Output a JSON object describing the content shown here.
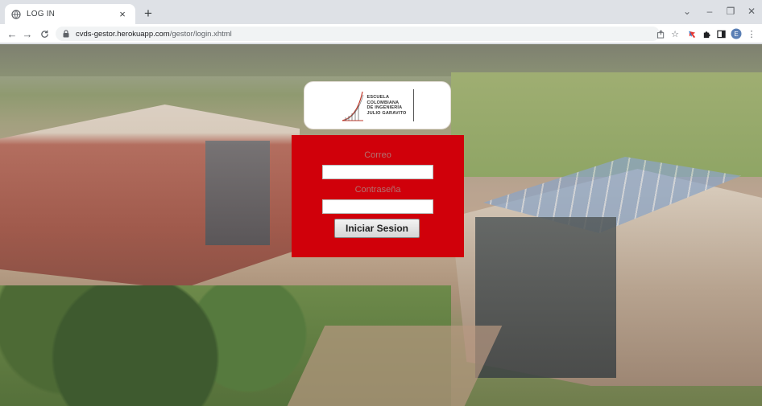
{
  "browser": {
    "tab": {
      "title": "LOG IN",
      "close": "×"
    },
    "new_tab": "+",
    "window": {
      "chevron": "⌄",
      "minimize": "–",
      "maximize": "❐",
      "close": "✕"
    },
    "nav": {
      "back": "←",
      "forward": "→",
      "reload": "C"
    },
    "url": {
      "host": "cvds-gestor.herokuapp.com",
      "path": "/gestor/login.xhtml"
    },
    "toolbar_icons": [
      "share-icon",
      "star-icon",
      "extension-icon",
      "puzzle-icon",
      "sidebar-icon",
      "profile-icon",
      "menu-icon"
    ],
    "profile_initial": "E"
  },
  "logo": {
    "lines": [
      "ESCUELA",
      "COLOMBIANA",
      "DE INGENIERÍA",
      "JULIO GARAVITO"
    ]
  },
  "login": {
    "email_label": "Correo",
    "password_label": "Contraseña",
    "email_value": "",
    "password_value": "",
    "submit_label": "Iniciar Sesion"
  },
  "colors": {
    "login_bg": "#d0000a",
    "label_color": "#b37070"
  }
}
